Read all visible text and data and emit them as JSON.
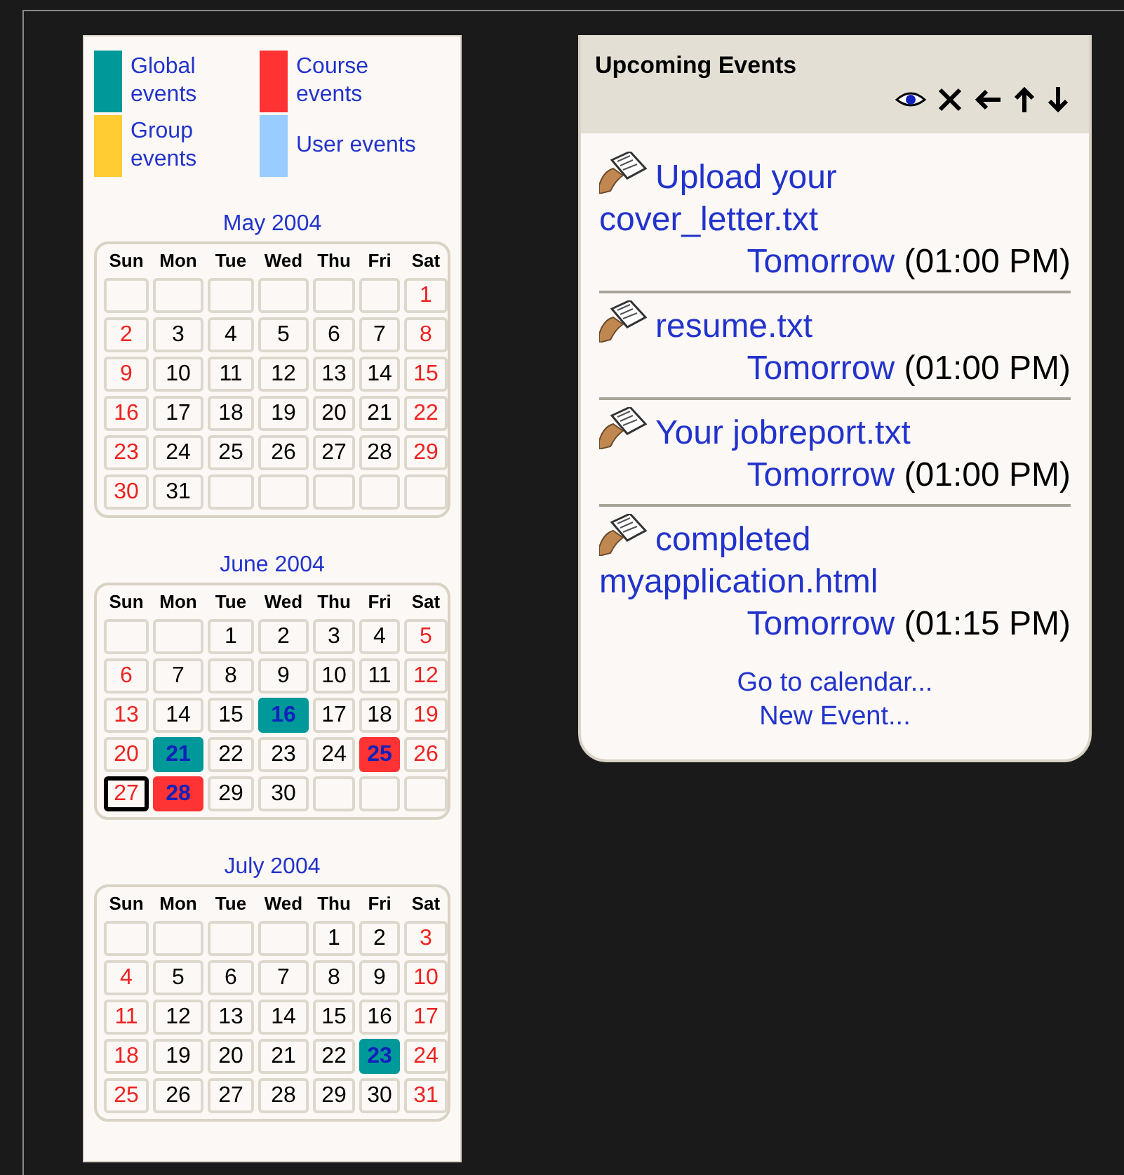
{
  "legend": [
    {
      "label": "Global events",
      "color": "#009999"
    },
    {
      "label": "Course events",
      "color": "#ff3333"
    },
    {
      "label": "Group events",
      "color": "#ffcc33"
    },
    {
      "label": "User events",
      "color": "#99ccff"
    }
  ],
  "months": [
    {
      "title": "May 2004",
      "weekdays": [
        "Sun",
        "Mon",
        "Tue",
        "Wed",
        "Thu",
        "Fri",
        "Sat"
      ],
      "weeks": [
        [
          {
            "kind": "blank"
          },
          {
            "kind": "blank"
          },
          {
            "kind": "blank"
          },
          {
            "kind": "blank"
          },
          {
            "kind": "blank"
          },
          {
            "kind": "blank"
          },
          {
            "kind": "day",
            "day": "1",
            "weekend": true,
            "today": false
          }
        ],
        [
          {
            "kind": "day",
            "day": "2",
            "weekend": true,
            "today": false
          },
          {
            "kind": "day",
            "day": "3",
            "weekend": false,
            "today": false
          },
          {
            "kind": "day",
            "day": "4",
            "weekend": false,
            "today": false
          },
          {
            "kind": "day",
            "day": "5",
            "weekend": false,
            "today": false
          },
          {
            "kind": "day",
            "day": "6",
            "weekend": false,
            "today": false
          },
          {
            "kind": "day",
            "day": "7",
            "weekend": false,
            "today": false
          },
          {
            "kind": "day",
            "day": "8",
            "weekend": true,
            "today": false
          }
        ],
        [
          {
            "kind": "day",
            "day": "9",
            "weekend": true,
            "today": false
          },
          {
            "kind": "day",
            "day": "10",
            "weekend": false,
            "today": false
          },
          {
            "kind": "day",
            "day": "11",
            "weekend": false,
            "today": false
          },
          {
            "kind": "day",
            "day": "12",
            "weekend": false,
            "today": false
          },
          {
            "kind": "day",
            "day": "13",
            "weekend": false,
            "today": false
          },
          {
            "kind": "day",
            "day": "14",
            "weekend": false,
            "today": false
          },
          {
            "kind": "day",
            "day": "15",
            "weekend": true,
            "today": false
          }
        ],
        [
          {
            "kind": "day",
            "day": "16",
            "weekend": true,
            "today": false
          },
          {
            "kind": "day",
            "day": "17",
            "weekend": false,
            "today": false
          },
          {
            "kind": "day",
            "day": "18",
            "weekend": false,
            "today": false
          },
          {
            "kind": "day",
            "day": "19",
            "weekend": false,
            "today": false
          },
          {
            "kind": "day",
            "day": "20",
            "weekend": false,
            "today": false
          },
          {
            "kind": "day",
            "day": "21",
            "weekend": false,
            "today": false
          },
          {
            "kind": "day",
            "day": "22",
            "weekend": true,
            "today": false
          }
        ],
        [
          {
            "kind": "day",
            "day": "23",
            "weekend": true,
            "today": false
          },
          {
            "kind": "day",
            "day": "24",
            "weekend": false,
            "today": false
          },
          {
            "kind": "day",
            "day": "25",
            "weekend": false,
            "today": false
          },
          {
            "kind": "day",
            "day": "26",
            "weekend": false,
            "today": false
          },
          {
            "kind": "day",
            "day": "27",
            "weekend": false,
            "today": false
          },
          {
            "kind": "day",
            "day": "28",
            "weekend": false,
            "today": false
          },
          {
            "kind": "day",
            "day": "29",
            "weekend": true,
            "today": false
          }
        ],
        [
          {
            "kind": "day",
            "day": "30",
            "weekend": true,
            "today": false
          },
          {
            "kind": "day",
            "day": "31",
            "weekend": false,
            "today": false
          },
          {
            "kind": "blank"
          },
          {
            "kind": "blank"
          },
          {
            "kind": "blank"
          },
          {
            "kind": "blank"
          },
          {
            "kind": "blank"
          }
        ]
      ]
    },
    {
      "title": "June 2004",
      "weekdays": [
        "Sun",
        "Mon",
        "Tue",
        "Wed",
        "Thu",
        "Fri",
        "Sat"
      ],
      "weeks": [
        [
          {
            "kind": "blank"
          },
          {
            "kind": "blank"
          },
          {
            "kind": "day",
            "day": "1",
            "weekend": false,
            "today": false
          },
          {
            "kind": "day",
            "day": "2",
            "weekend": false,
            "today": false
          },
          {
            "kind": "day",
            "day": "3",
            "weekend": false,
            "today": false
          },
          {
            "kind": "day",
            "day": "4",
            "weekend": false,
            "today": false
          },
          {
            "kind": "day",
            "day": "5",
            "weekend": true,
            "today": false
          }
        ],
        [
          {
            "kind": "day",
            "day": "6",
            "weekend": true,
            "today": false
          },
          {
            "kind": "day",
            "day": "7",
            "weekend": false,
            "today": false
          },
          {
            "kind": "day",
            "day": "8",
            "weekend": false,
            "today": false
          },
          {
            "kind": "day",
            "day": "9",
            "weekend": false,
            "today": false
          },
          {
            "kind": "day",
            "day": "10",
            "weekend": false,
            "today": false
          },
          {
            "kind": "day",
            "day": "11",
            "weekend": false,
            "today": false
          },
          {
            "kind": "day",
            "day": "12",
            "weekend": true,
            "today": false
          }
        ],
        [
          {
            "kind": "day",
            "day": "13",
            "weekend": true,
            "today": false
          },
          {
            "kind": "day",
            "day": "14",
            "weekend": false,
            "today": false
          },
          {
            "kind": "day",
            "day": "15",
            "weekend": false,
            "today": false
          },
          {
            "kind": "event",
            "day": "16",
            "color": "#009999",
            "today": false
          },
          {
            "kind": "day",
            "day": "17",
            "weekend": false,
            "today": false
          },
          {
            "kind": "day",
            "day": "18",
            "weekend": false,
            "today": false
          },
          {
            "kind": "day",
            "day": "19",
            "weekend": true,
            "today": false
          }
        ],
        [
          {
            "kind": "day",
            "day": "20",
            "weekend": true,
            "today": false
          },
          {
            "kind": "event",
            "day": "21",
            "color": "#009999",
            "today": false
          },
          {
            "kind": "day",
            "day": "22",
            "weekend": false,
            "today": false
          },
          {
            "kind": "day",
            "day": "23",
            "weekend": false,
            "today": false
          },
          {
            "kind": "day",
            "day": "24",
            "weekend": false,
            "today": false
          },
          {
            "kind": "event",
            "day": "25",
            "color": "#ff3333",
            "today": false
          },
          {
            "kind": "day",
            "day": "26",
            "weekend": true,
            "today": false
          }
        ],
        [
          {
            "kind": "day",
            "day": "27",
            "weekend": true,
            "today": true
          },
          {
            "kind": "event",
            "day": "28",
            "color": "#ff3333",
            "today": false
          },
          {
            "kind": "day",
            "day": "29",
            "weekend": false,
            "today": false
          },
          {
            "kind": "day",
            "day": "30",
            "weekend": false,
            "today": false
          },
          {
            "kind": "blank"
          },
          {
            "kind": "blank"
          },
          {
            "kind": "blank"
          }
        ]
      ]
    },
    {
      "title": "July 2004",
      "weekdays": [
        "Sun",
        "Mon",
        "Tue",
        "Wed",
        "Thu",
        "Fri",
        "Sat"
      ],
      "weeks": [
        [
          {
            "kind": "blank"
          },
          {
            "kind": "blank"
          },
          {
            "kind": "blank"
          },
          {
            "kind": "blank"
          },
          {
            "kind": "day",
            "day": "1",
            "weekend": false,
            "today": false
          },
          {
            "kind": "day",
            "day": "2",
            "weekend": false,
            "today": false
          },
          {
            "kind": "day",
            "day": "3",
            "weekend": true,
            "today": false
          }
        ],
        [
          {
            "kind": "day",
            "day": "4",
            "weekend": true,
            "today": false
          },
          {
            "kind": "day",
            "day": "5",
            "weekend": false,
            "today": false
          },
          {
            "kind": "day",
            "day": "6",
            "weekend": false,
            "today": false
          },
          {
            "kind": "day",
            "day": "7",
            "weekend": false,
            "today": false
          },
          {
            "kind": "day",
            "day": "8",
            "weekend": false,
            "today": false
          },
          {
            "kind": "day",
            "day": "9",
            "weekend": false,
            "today": false
          },
          {
            "kind": "day",
            "day": "10",
            "weekend": true,
            "today": false
          }
        ],
        [
          {
            "kind": "day",
            "day": "11",
            "weekend": true,
            "today": false
          },
          {
            "kind": "day",
            "day": "12",
            "weekend": false,
            "today": false
          },
          {
            "kind": "day",
            "day": "13",
            "weekend": false,
            "today": false
          },
          {
            "kind": "day",
            "day": "14",
            "weekend": false,
            "today": false
          },
          {
            "kind": "day",
            "day": "15",
            "weekend": false,
            "today": false
          },
          {
            "kind": "day",
            "day": "16",
            "weekend": false,
            "today": false
          },
          {
            "kind": "day",
            "day": "17",
            "weekend": true,
            "today": false
          }
        ],
        [
          {
            "kind": "day",
            "day": "18",
            "weekend": true,
            "today": false
          },
          {
            "kind": "day",
            "day": "19",
            "weekend": false,
            "today": false
          },
          {
            "kind": "day",
            "day": "20",
            "weekend": false,
            "today": false
          },
          {
            "kind": "day",
            "day": "21",
            "weekend": false,
            "today": false
          },
          {
            "kind": "day",
            "day": "22",
            "weekend": false,
            "today": false
          },
          {
            "kind": "event",
            "day": "23",
            "color": "#009999",
            "today": false
          },
          {
            "kind": "day",
            "day": "24",
            "weekend": true,
            "today": false
          }
        ],
        [
          {
            "kind": "day",
            "day": "25",
            "weekend": true,
            "today": false
          },
          {
            "kind": "day",
            "day": "26",
            "weekend": false,
            "today": false
          },
          {
            "kind": "day",
            "day": "27",
            "weekend": false,
            "today": false
          },
          {
            "kind": "day",
            "day": "28",
            "weekend": false,
            "today": false
          },
          {
            "kind": "day",
            "day": "29",
            "weekend": false,
            "today": false
          },
          {
            "kind": "day",
            "day": "30",
            "weekend": false,
            "today": false
          },
          {
            "kind": "day",
            "day": "31",
            "weekend": true,
            "today": false
          }
        ]
      ]
    }
  ],
  "upcoming": {
    "title": "Upcoming Events",
    "events": [
      {
        "title": "Upload your cover_letter.txt",
        "date": "Tomorrow",
        "time": "(01:00 PM)"
      },
      {
        "title": "resume.txt",
        "date": "Tomorrow",
        "time": "(01:00 PM)"
      },
      {
        "title": "Your jobreport.txt",
        "date": "Tomorrow",
        "time": "(01:00 PM)"
      },
      {
        "title": "completed myapplication.html",
        "date": "Tomorrow",
        "time": "(01:15 PM)"
      }
    ],
    "links": [
      "Go to calendar...",
      "New Event..."
    ]
  }
}
